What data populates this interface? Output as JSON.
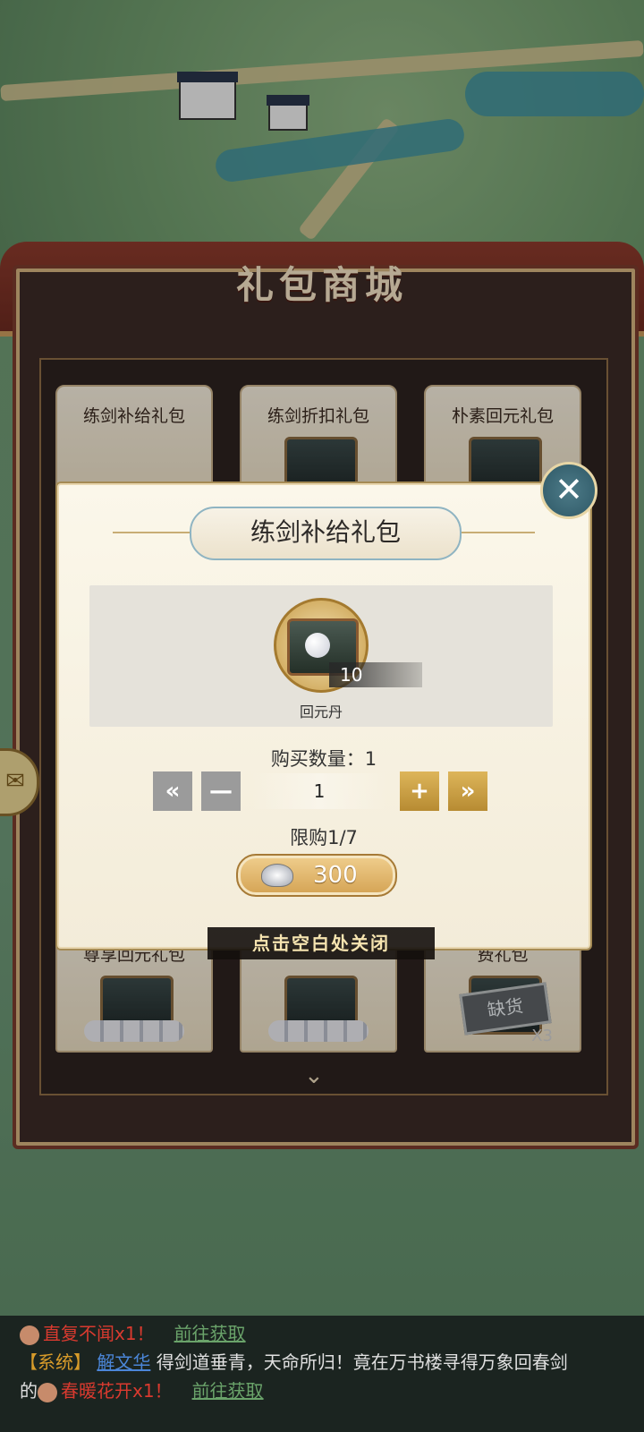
{
  "shop": {
    "title": "礼包商城",
    "top_row": [
      "练剑补给礼包",
      "练剑折扣礼包",
      "朴素回元礼包"
    ],
    "bottom_row": [
      "尊享回元礼包",
      "",
      "费礼包"
    ],
    "soldout_label": "缺货",
    "soldout_count": "X3"
  },
  "modal": {
    "title": "练剑补给礼包",
    "item_qty": "10",
    "item_name": "回元丹",
    "qty_label": "购买数量：1",
    "qty_value": "1",
    "limit": "限购1/7",
    "price": "300",
    "close_hint": "点击空白处关闭"
  },
  "icons": {
    "close": "close-icon",
    "minus_all": "double-left-icon",
    "minus": "minus-icon",
    "plus": "plus-icon",
    "plus_all": "double-right-icon",
    "currency": "silver-ingot-icon",
    "chevron": "chevron-down-icon"
  },
  "chat": {
    "line1_item": "直复不闻x1",
    "line1_mark": "！",
    "line1_link": "前往获取",
    "line2_tag": "【系统】",
    "line2_user": "解文华",
    "line2_text": "得剑道垂青，天命所归！竟在万书楼寻得万象回春剑",
    "line3_prefix": "的",
    "line3_item": "春暖花开x1",
    "line3_mark": "！",
    "line3_link": "前往获取"
  }
}
